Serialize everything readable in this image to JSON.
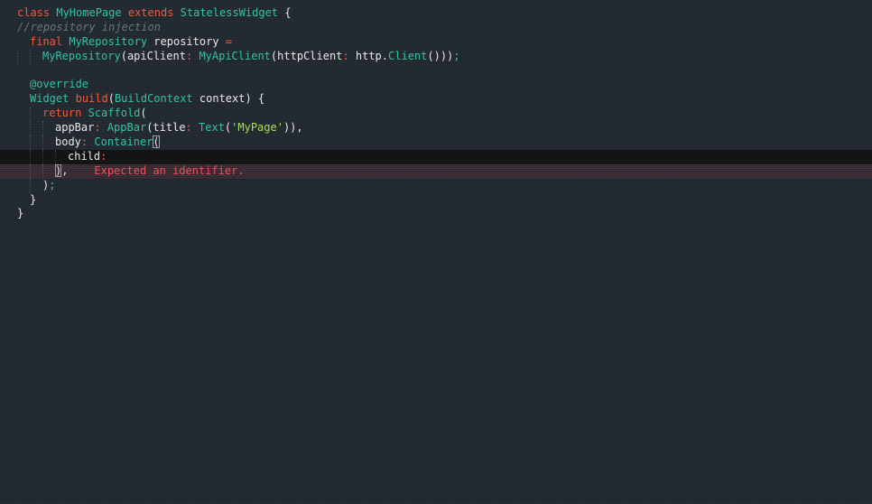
{
  "editor": {
    "colors": {
      "background": "#232931",
      "keyword": "#f25a3d",
      "type": "#2ec4a5",
      "string": "#a8e04a",
      "comment": "#6d7481",
      "error": "#e8545a"
    },
    "code": {
      "l1": {
        "kw_class": "class",
        "class_name": "MyHomePage",
        "kw_extends": "extends",
        "super": "StatelessWidget",
        "brace": " {"
      },
      "l2": {
        "comment": "//repository injection"
      },
      "l3": {
        "kw_final": "final",
        "type": "MyRepository",
        "name": "repository",
        "eq": "="
      },
      "l4": {
        "ctor": "MyRepository",
        "p1": "(",
        "arg1": "apiClient",
        "colon1": ":",
        "ctor2": "MyApiClient",
        "p2": "(",
        "arg2": "httpClient",
        "colon2": ":",
        "ns": "http",
        "dot": ".",
        "ctor3": "Client",
        "close": "()))",
        "semi": ";"
      },
      "l5": {},
      "l6": {
        "annotation": "@override"
      },
      "l7": {
        "type": "Widget",
        "method": "build",
        "p1": "(",
        "ptype": "BuildContext",
        "pname": "context",
        "p2": ") {"
      },
      "l8": {
        "kw_return": "return",
        "ctor": "Scaffold",
        "p": "("
      },
      "l9": {
        "arg": "appBar",
        "colon": ":",
        "ctor": "AppBar",
        "p1": "(",
        "arg2": "title",
        "colon2": ":",
        "ctor2": "Text",
        "p2": "(",
        "str": "'MyPage'",
        "close": ")),"
      },
      "l10": {
        "arg": "body",
        "colon": ":",
        "ctor": "Container",
        "p": "("
      },
      "l11": {
        "arg": "child",
        "colon": ":"
      },
      "l12": {
        "bracket": ")",
        "comma": ",",
        "error": "Expected an identifier."
      },
      "l13": {
        "close": ")",
        "semi": ";"
      },
      "l14": {
        "brace": "}"
      },
      "l15": {
        "brace": "}"
      }
    }
  }
}
